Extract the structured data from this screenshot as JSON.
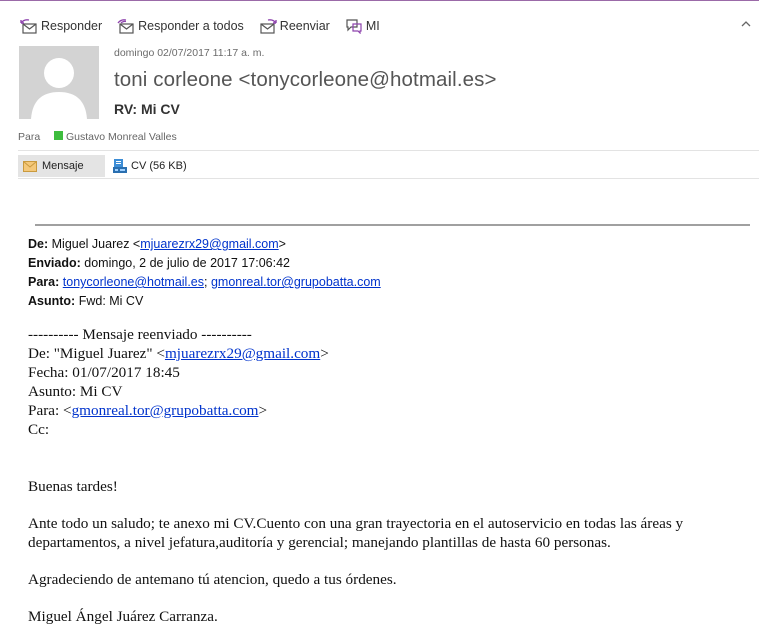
{
  "toolbar": {
    "reply": "Responder",
    "reply_all": "Responder a todos",
    "forward": "Reenviar",
    "im": "MI"
  },
  "message": {
    "date": "domingo 02/07/2017 11:17 a. m.",
    "sender": "toni corleone <tonycorleone@hotmail.es>",
    "subject": "RV: Mi CV",
    "to_label": "Para",
    "to_name": "Gustavo Monreal Valles"
  },
  "attachments": {
    "message_tab": "Mensaje",
    "file": "CV (56 KB)"
  },
  "forward_header": {
    "from_label": "De:",
    "from_name": "Miguel Juarez <",
    "from_email": "mjuarezrx29@gmail.com",
    "from_end": ">",
    "sent_label": "Enviado:",
    "sent_value": "domingo, 2 de julio de 2017 17:06:42",
    "to_label": "Para:",
    "to_email1": "tonycorleone@hotmail.es",
    "to_sep": ";",
    "to_email2": "gmonreal.tor@grupobatta.com",
    "subject_label": "Asunto:",
    "subject_value": "Fwd: Mi CV"
  },
  "body": {
    "fwd_banner": "---------- Mensaje reenviado ----------",
    "from_prefix": "De: \"Miguel Juarez\" <",
    "from_email": "mjuarezrx29@gmail.com",
    "from_end": ">",
    "date_line": "Fecha: 01/07/2017 18:45",
    "subject_line": "Asunto: Mi CV",
    "to_prefix": "Para: <",
    "to_email": "gmonreal.tor@grupobatta.com",
    "to_end": ">",
    "cc_line": "Cc:",
    "greeting": "Buenas tardes!",
    "para1": "Ante todo un saludo; te anexo mi CV.Cuento con una gran trayectoria en el autoservicio en todas las áreas y departamentos, a nivel jefatura,auditoría y gerencial; manejando plantillas de hasta 60 personas.",
    "para2": "Agradeciendo de antemano tú atencion, quedo a tus órdenes.",
    "signature": "Miguel Ángel Juárez Carranza."
  },
  "colors": {
    "accent": "#9b6aa8",
    "link": "#0033cc",
    "presence": "#3ebd3e"
  }
}
